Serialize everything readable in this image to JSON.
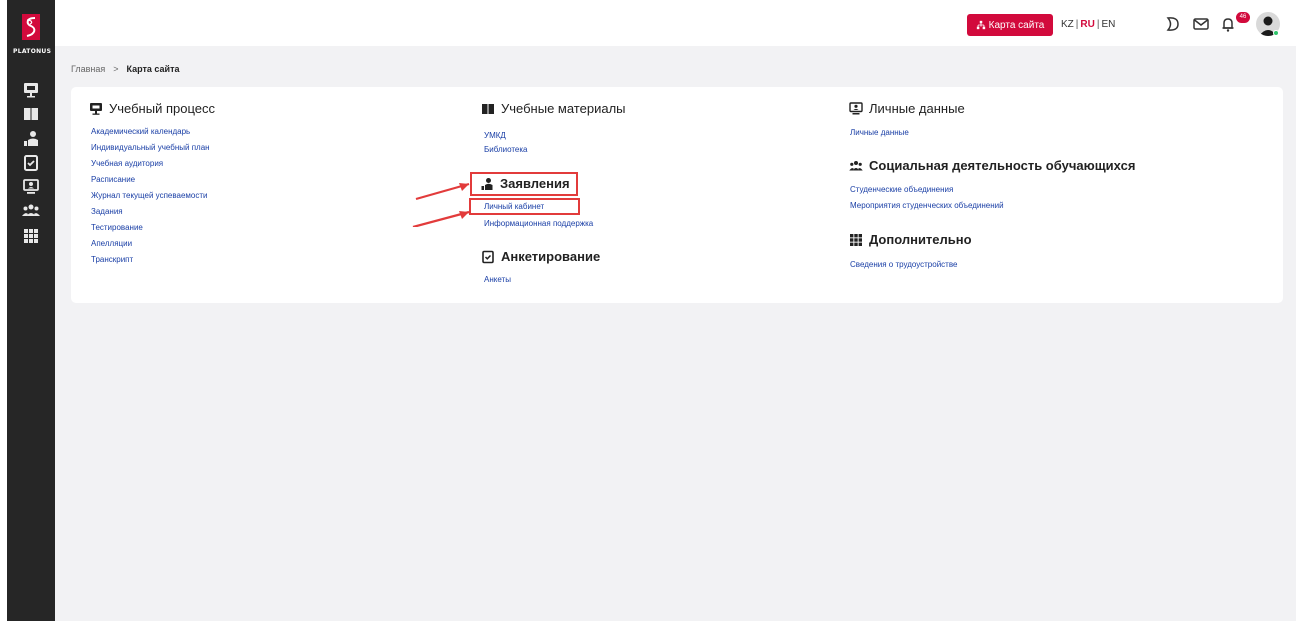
{
  "brand": {
    "name": "PLATONUS"
  },
  "sidebar": {
    "icons": [
      "monitor-icon",
      "book-icon",
      "applicant-icon",
      "checklist-icon",
      "personal-data-icon",
      "group-icon",
      "grid-icon"
    ]
  },
  "header": {
    "sitemap_label": "Карта сайта",
    "languages": [
      "KZ",
      "RU",
      "EN"
    ],
    "active_language": "RU",
    "notification_count": "46"
  },
  "breadcrumb": {
    "home": "Главная",
    "separator": ">",
    "current": "Карта сайта"
  },
  "sections": {
    "study": {
      "title": "Учебный процесс",
      "links": [
        "Академический календарь",
        "Индивидуальный учебный план",
        "Учебная аудитория",
        "Расписание",
        "Журнал текущей успеваемости",
        "Задания",
        "Тестирование",
        "Апелляции",
        "Транскрипт"
      ]
    },
    "materials": {
      "title": "Учебные материалы",
      "links": [
        "УМКД",
        "Библиотека"
      ]
    },
    "applications": {
      "title": "Заявления",
      "links": [
        "Личный кабинет",
        "Информационная поддержка"
      ]
    },
    "surveys": {
      "title": "Анкетирование",
      "links": [
        "Анкеты"
      ]
    },
    "personal": {
      "title": "Личные данные",
      "links": [
        "Личные данные"
      ]
    },
    "social": {
      "title": "Социальная деятельность обучающихся",
      "links": [
        "Студенческие объединения",
        "Мероприятия студенческих объединений"
      ]
    },
    "extra": {
      "title": "Дополнительно",
      "links": [
        "Сведения о трудоустройстве"
      ]
    }
  },
  "colors": {
    "accent": "#d20a3c",
    "link": "#1a3fa6",
    "sidebar": "#262626",
    "highlight": "#e23b3b"
  }
}
